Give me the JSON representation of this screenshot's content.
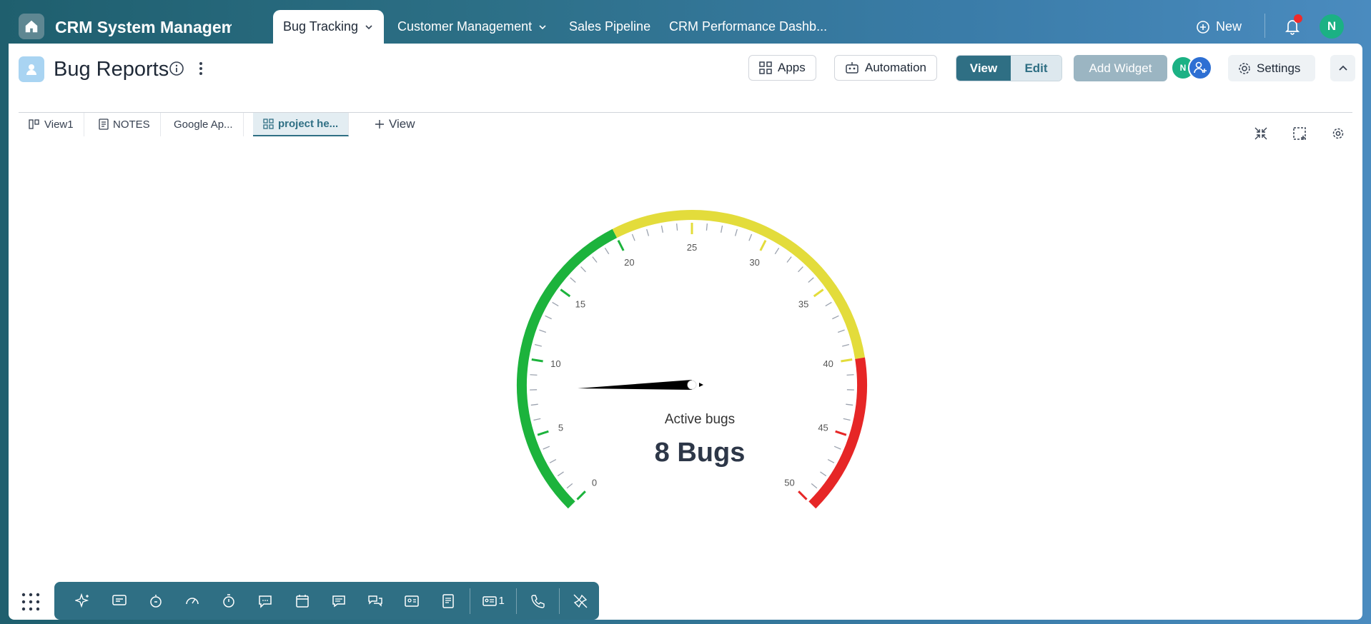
{
  "app": {
    "title": "CRM System Management"
  },
  "nav": {
    "tabs": [
      {
        "label": "Bug Tracking",
        "active": true,
        "has_dropdown": true
      },
      {
        "label": "Customer Management",
        "has_dropdown": true
      },
      {
        "label": "Sales Pipeline"
      },
      {
        "label": "CRM Performance Dashb..."
      }
    ],
    "new_label": "New",
    "user_initial": "N"
  },
  "page": {
    "title": "Bug Reports",
    "buttons": {
      "apps": "Apps",
      "automation": "Automation",
      "view": "View",
      "edit": "Edit",
      "add_widget": "Add Widget",
      "settings": "Settings"
    },
    "avatar_initial": "N"
  },
  "views": [
    {
      "label": "View1",
      "icon": "view-icon"
    },
    {
      "label": "NOTES",
      "icon": "notes-icon"
    },
    {
      "label": "Google Ap...",
      "icon": ""
    },
    {
      "label": "project he...",
      "icon": "grid-icon",
      "active": true
    },
    {
      "label": "View",
      "icon": "plus-icon"
    }
  ],
  "gauge": {
    "label": "Active bugs",
    "value_text": "8 Bugs",
    "value": 8,
    "min": 0,
    "max": 50,
    "tick_labels": [
      0,
      5,
      10,
      15,
      20,
      25,
      30,
      35,
      40,
      45,
      50
    ],
    "bands": [
      {
        "from": 0,
        "to": 20,
        "color": "#1cb33c"
      },
      {
        "from": 20,
        "to": 40,
        "color": "#e3dc3b"
      },
      {
        "from": 40,
        "to": 50,
        "color": "#e62626"
      }
    ]
  },
  "dock": {
    "items": [
      "ai-sparkle-icon",
      "message-icon",
      "timer-icon",
      "speedometer-icon",
      "stopwatch-icon",
      "chat-icon",
      "calendar-icon",
      "comment-icon",
      "conversation-icon",
      "contact-card-icon",
      "document-icon"
    ],
    "cards_count": "1"
  }
}
